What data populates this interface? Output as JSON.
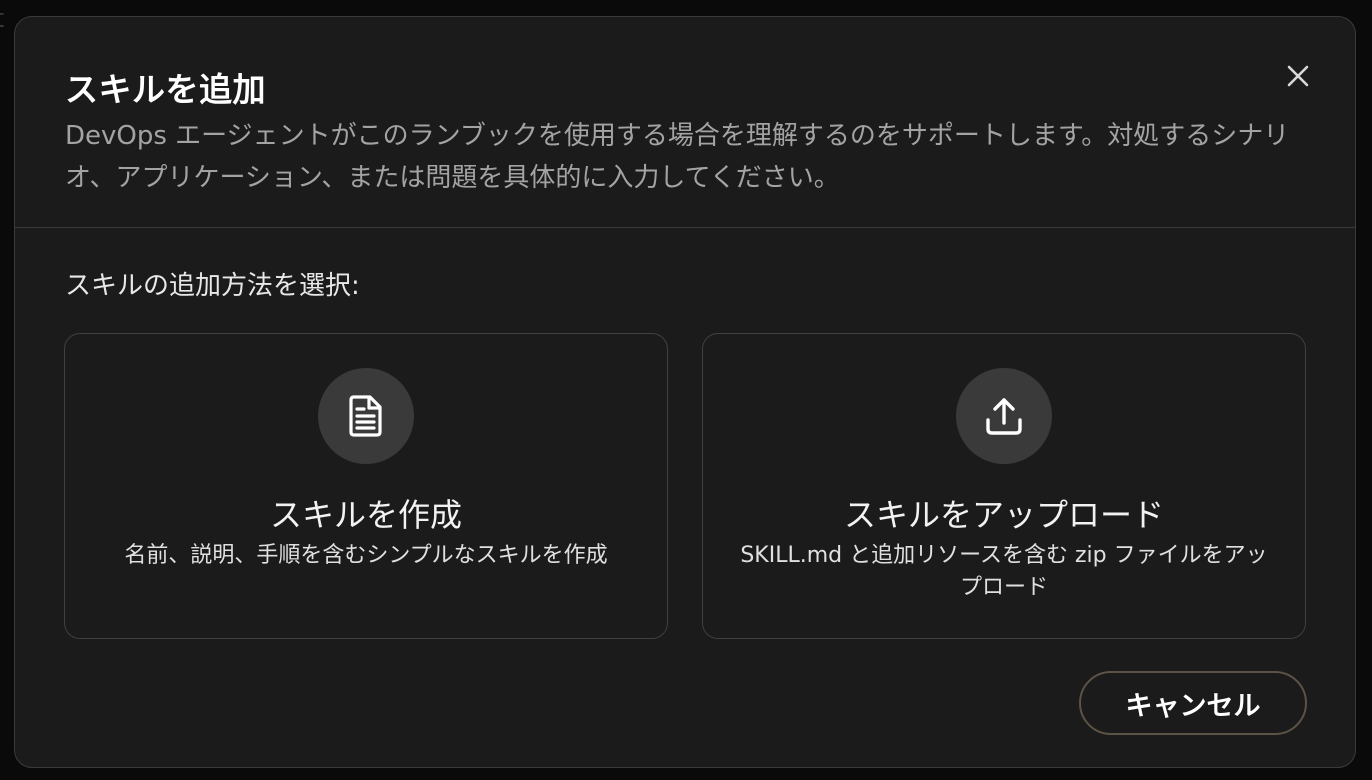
{
  "modal": {
    "title": "スキルを追加",
    "description": "DevOps エージェントがこのランブックを使用する場合を理解するのをサポートします。対処するシナリオ、アプリケーション、または問題を具体的に入力してください。",
    "close_icon": "close-icon",
    "prompt": "スキルの追加方法を選択:",
    "options": [
      {
        "icon": "document-icon",
        "title": "スキルを作成",
        "description": "名前、説明、手順を含むシンプルなスキルを作成"
      },
      {
        "icon": "upload-icon",
        "title": "スキルをアップロード",
        "description": "SKILL.md と追加リソースを含む zip ファイルをアップロード"
      }
    ],
    "cancel_label": "キャンセル"
  },
  "colors": {
    "modal_bg": "#1b1b1b",
    "border": "#3b3b3b",
    "icon_circle": "#3a3a3a",
    "title_text": "#ffffff",
    "description_text": "#a3a3a3"
  }
}
